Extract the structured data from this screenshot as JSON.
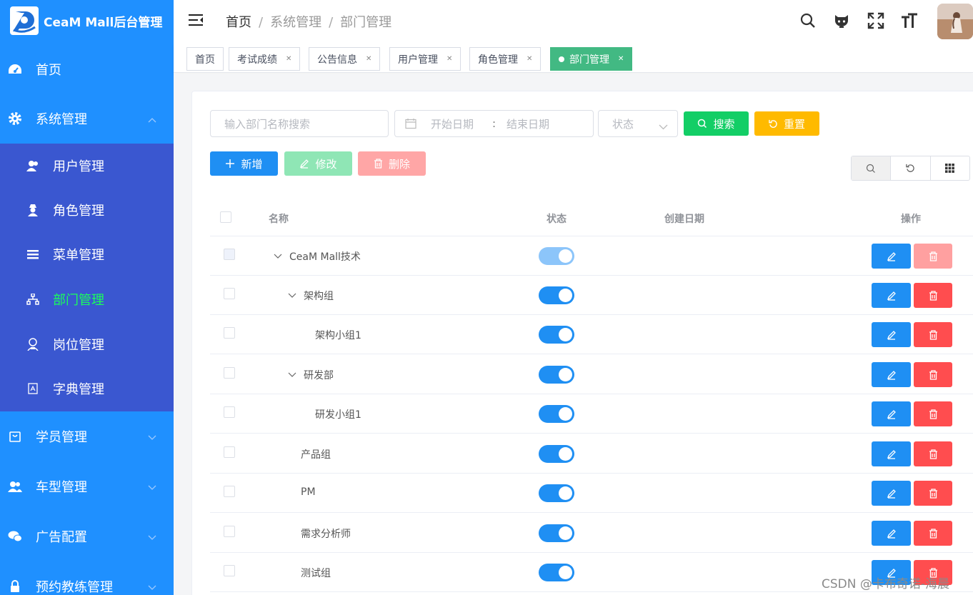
{
  "app": {
    "title": "CeaM Mall后台管理"
  },
  "sidebar": {
    "items": [
      {
        "label": "首页",
        "icon": "dashboard-icon"
      },
      {
        "label": "系统管理",
        "icon": "gear-icon",
        "expanded": true
      },
      {
        "label": "学员管理",
        "icon": "bag-icon"
      },
      {
        "label": "车型管理",
        "icon": "users-icon"
      },
      {
        "label": "广告配置",
        "icon": "wechat-icon"
      },
      {
        "label": "预约教练管理",
        "icon": "lock-icon"
      }
    ],
    "submenu": [
      {
        "label": "用户管理",
        "icon": "user-icon"
      },
      {
        "label": "角色管理",
        "icon": "spy-icon"
      },
      {
        "label": "菜单管理",
        "icon": "list-icon"
      },
      {
        "label": "部门管理",
        "icon": "tree-icon",
        "active": true
      },
      {
        "label": "岗位管理",
        "icon": "badge-icon"
      },
      {
        "label": "字典管理",
        "icon": "dict-icon"
      }
    ]
  },
  "header": {
    "breadcrumb": [
      "首页",
      "系统管理",
      "部门管理"
    ]
  },
  "tabs": [
    {
      "label": "首页"
    },
    {
      "label": "考试成绩"
    },
    {
      "label": "公告信息"
    },
    {
      "label": "用户管理"
    },
    {
      "label": "角色管理"
    },
    {
      "label": "部门管理",
      "active": true
    }
  ],
  "search": {
    "dept_placeholder": "输入部门名称搜索",
    "start_placeholder": "开始日期",
    "range_sep": ":",
    "end_placeholder": "结束日期",
    "status_placeholder": "状态",
    "search_label": "搜索",
    "reset_label": "重置"
  },
  "toolbar": {
    "add_label": "新增",
    "edit_label": "修改",
    "delete_label": "删除"
  },
  "table": {
    "headers": {
      "name": "名称",
      "status": "状态",
      "created": "创建日期",
      "actions": "操作"
    },
    "rows": [
      {
        "name": "CeaM Mall技术",
        "level": 0,
        "expandable": true,
        "enabled": true
      },
      {
        "name": "架构组",
        "level": 1,
        "expandable": true,
        "enabled": true
      },
      {
        "name": "架构小组1",
        "level": 2,
        "expandable": false,
        "enabled": true
      },
      {
        "name": "研发部",
        "level": 1,
        "expandable": true,
        "enabled": true
      },
      {
        "name": "研发小组1",
        "level": 2,
        "expandable": false,
        "enabled": true
      },
      {
        "name": "产品组",
        "level": 1,
        "expandable": false,
        "enabled": true
      },
      {
        "name": "PM",
        "level": 1,
        "expandable": false,
        "enabled": true
      },
      {
        "name": "需求分析师",
        "level": 1,
        "expandable": false,
        "enabled": true
      },
      {
        "name": "测试组",
        "level": 1,
        "expandable": false,
        "enabled": true
      }
    ]
  },
  "watermark": "CSDN @卡布奇诺-海晨",
  "colors": {
    "sidebar": "#1f90ff",
    "submenu": "#3a57d0",
    "active_menu_text": "#1aff5a",
    "primary": "#1f8ff3",
    "danger": "#ff4d4f",
    "success": "#13ce66",
    "warning": "#ffba00",
    "tab_active": "#42b983"
  }
}
